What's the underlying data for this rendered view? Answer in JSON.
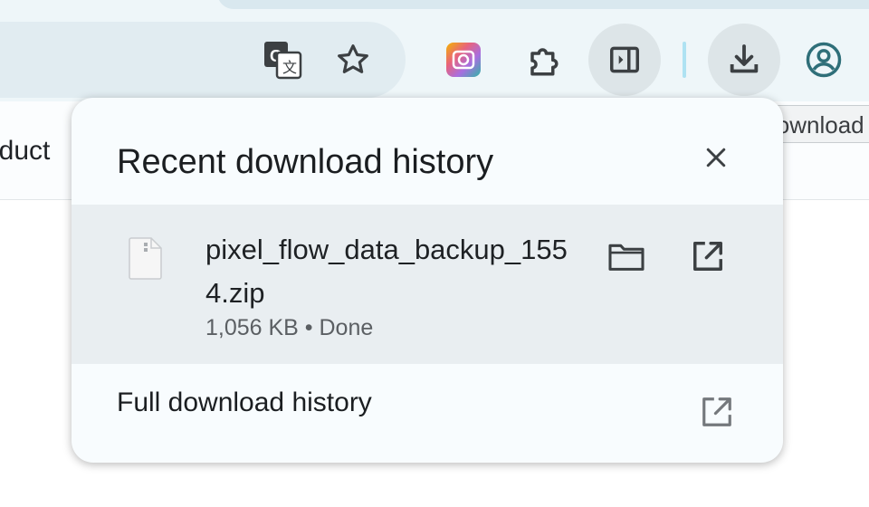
{
  "toolbar": {
    "icons": [
      "google-translate-icon",
      "bookmark-star-icon",
      "extension-app-icon",
      "extensions-puzzle-icon",
      "side-panel-icon",
      "download-icon",
      "profile-icon"
    ],
    "tooltip": "Download"
  },
  "bookmarks_bar": {
    "partial_text": "oduct"
  },
  "popup": {
    "title": "Recent download history",
    "close_icon": "close-icon",
    "download": {
      "file_name": "pixel_flow_data_backup_1554.zip",
      "meta": "1,056 KB • Done",
      "actions": [
        "show-in-folder-icon",
        "open-file-icon"
      ]
    },
    "full_history_label": "Full download history"
  },
  "colors": {
    "popup_bg": "#f8fcfe",
    "row_bg": "#e9eef1",
    "toolbar_bg": "#eef6f9",
    "accent": "#aee2f2",
    "profile_icon": "#2f6f79"
  }
}
